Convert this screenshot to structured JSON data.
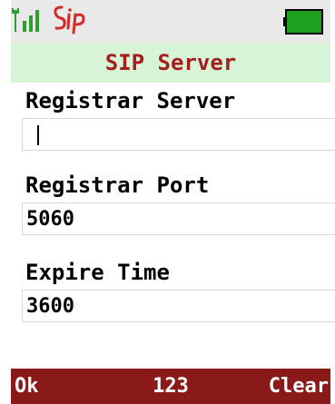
{
  "status": {
    "signal_icon": "signal-strength-icon",
    "logo_icon": "sip-logo-icon",
    "battery_icon": "battery-full-icon"
  },
  "colors": {
    "title_bg": "#d7f4d7",
    "title_text": "#a31f1f",
    "softkey_bg": "#8a1a1a",
    "battery_fill": "#1e9e1e",
    "signal_green": "#2e9e2e"
  },
  "header": {
    "title": "SIP Server"
  },
  "form": {
    "registrar_server_label": "Registrar Server",
    "registrar_server_value": "",
    "registrar_port_label": "Registrar Port",
    "registrar_port_value": "5060",
    "expire_time_label": "Expire Time",
    "expire_time_value": "3600"
  },
  "softkeys": {
    "left": "Ok",
    "middle": "123",
    "right": "Clear"
  }
}
